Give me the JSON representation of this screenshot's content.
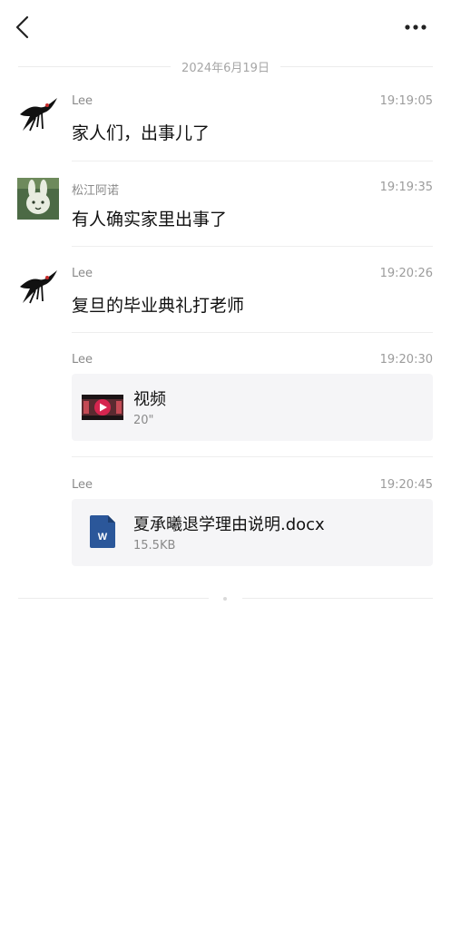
{
  "header": {
    "back_icon": "chevron-left-icon",
    "more_icon": "more-dots-icon"
  },
  "date_separator": "2024年6月19日",
  "messages": [
    {
      "sender": "Lee",
      "time": "19:19:05",
      "text": "家人们，出事儿了"
    },
    {
      "sender": "松江阿诺",
      "time": "19:19:35",
      "text": "有人确实家里出事了"
    },
    {
      "sender": "Lee",
      "time": "19:20:26",
      "text": "复旦的毕业典礼打老师"
    },
    {
      "sender": "Lee",
      "time": "19:20:30",
      "video": {
        "title": "视频",
        "duration": "20\""
      }
    },
    {
      "sender": "Lee",
      "time": "19:20:45",
      "file": {
        "name": "夏承曦退学理由说明.docx",
        "size": "15.5KB",
        "icon_letter": "W"
      }
    }
  ],
  "colors": {
    "doc_icon": "#2b579a",
    "card_bg": "#f5f5f7",
    "video_accent": "#d6254f"
  }
}
